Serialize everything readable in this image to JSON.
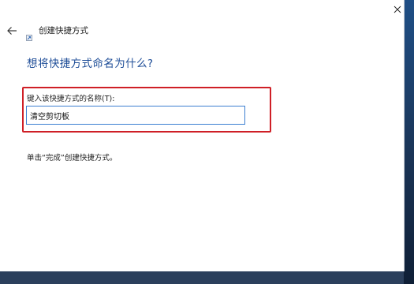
{
  "window": {
    "title": "创建快捷方式",
    "close_icon": "close-icon",
    "back_icon": "back-arrow-icon",
    "app_icon": "shortcut-icon"
  },
  "main": {
    "heading": "想将快捷方式命名为什么?",
    "name_field": {
      "label": "键入该快捷方式的名称(T):",
      "value": "清空剪切板"
    },
    "hint": "单击“完成”创建快捷方式。"
  },
  "colors": {
    "heading": "#1f4e98",
    "highlight": "#cf1f26",
    "input_border": "#3d7fd1"
  }
}
